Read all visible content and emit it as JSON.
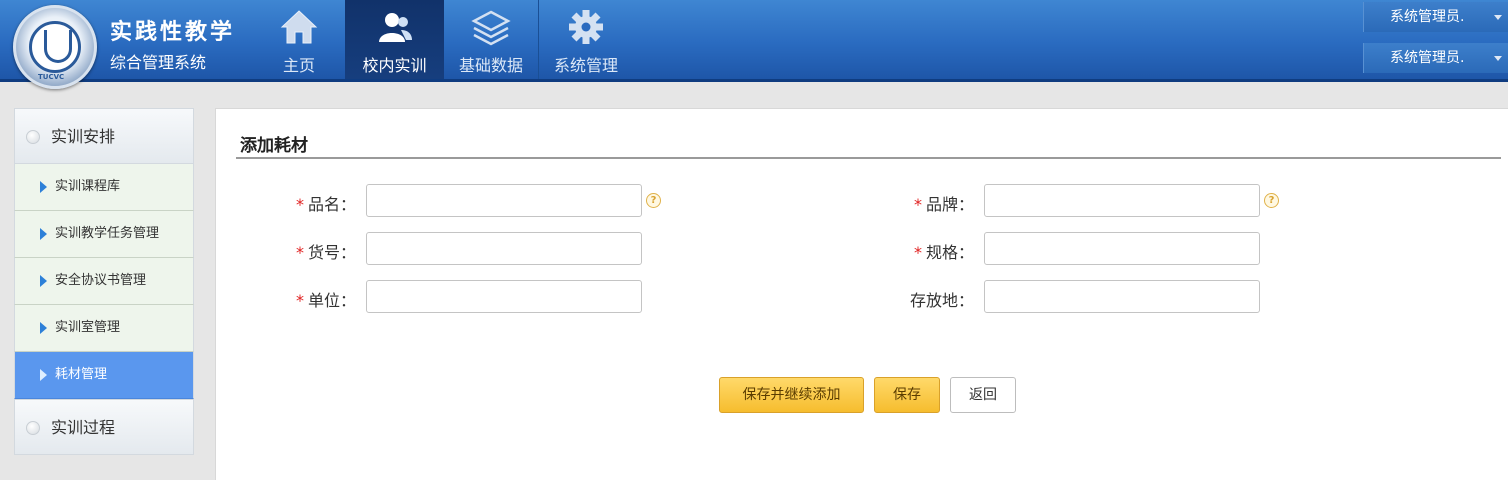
{
  "header": {
    "brand_title": "实践性教学",
    "brand_subtitle": "综合管理系统",
    "logo_text": "TUCVC",
    "nav": [
      {
        "label": "主页",
        "icon": "home-icon"
      },
      {
        "label": "校内实训",
        "icon": "users-icon",
        "active": true
      },
      {
        "label": "基础数据",
        "icon": "layers-icon"
      },
      {
        "label": "系统管理",
        "icon": "gear-icon"
      }
    ],
    "user_top": "系统管理员.",
    "user_bottom": "系统管理员."
  },
  "sidebar": {
    "group1": "实训安排",
    "items": [
      {
        "label": "实训课程库"
      },
      {
        "label": "实训教学任务管理"
      },
      {
        "label": "安全协议书管理"
      },
      {
        "label": "实训室管理"
      },
      {
        "label": "耗材管理",
        "active": true
      }
    ],
    "group2": "实训过程"
  },
  "main": {
    "title": "添加耗材",
    "required_mark": "*",
    "fields": {
      "name": {
        "label": "品名：",
        "value": ""
      },
      "brand": {
        "label": "品牌：",
        "value": ""
      },
      "code": {
        "label": "货号：",
        "value": ""
      },
      "spec": {
        "label": "规格：",
        "value": ""
      },
      "unit": {
        "label": "单位：",
        "value": ""
      },
      "location": {
        "label": "存放地：",
        "value": ""
      }
    },
    "help_glyph": "?",
    "buttons": {
      "save_continue": "保存并继续添加",
      "save": "保存",
      "back": "返回"
    }
  },
  "colors": {
    "header_blue": "#2a6bc0",
    "active_nav": "#163e7e",
    "sidebar_active": "#5a97ee",
    "required": "#e02020",
    "button_yellow": "#f6bd2e"
  }
}
